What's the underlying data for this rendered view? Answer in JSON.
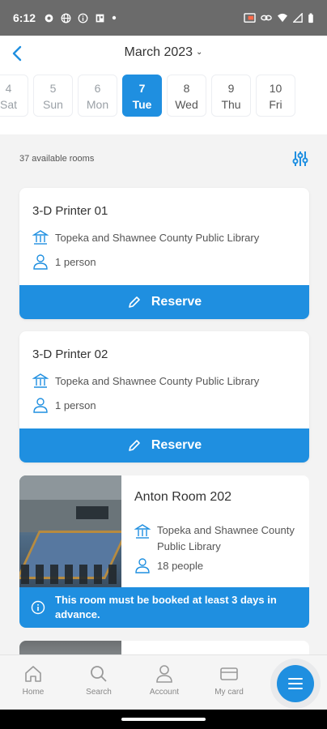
{
  "status_bar": {
    "time": "6:12"
  },
  "header": {
    "month_label": "March 2023"
  },
  "days": [
    {
      "num": "4",
      "dow": "Sat"
    },
    {
      "num": "5",
      "dow": "Sun"
    },
    {
      "num": "6",
      "dow": "Mon"
    },
    {
      "num": "7",
      "dow": "Tue"
    },
    {
      "num": "8",
      "dow": "Wed"
    },
    {
      "num": "9",
      "dow": "Thu"
    },
    {
      "num": "10",
      "dow": "Fri"
    }
  ],
  "selected_day": "7",
  "list": {
    "count_label": "37 available rooms"
  },
  "rooms": [
    {
      "name": "3-D Printer 01",
      "library": "Topeka and Shawnee County Public Library",
      "capacity": "1 person",
      "action_label": "Reserve"
    },
    {
      "name": "3-D Printer 02",
      "library": "Topeka and Shawnee County Public Library",
      "capacity": "1 person",
      "action_label": "Reserve"
    },
    {
      "name": "Anton Room 202",
      "library": "Topeka and Shawnee County Public Library",
      "capacity": "18 people",
      "notice": "This room must be booked at least 3 days in advance."
    }
  ],
  "bottom_nav": [
    {
      "label": "Home",
      "icon": "home-icon"
    },
    {
      "label": "Search",
      "icon": "search-icon"
    },
    {
      "label": "Account",
      "icon": "account-icon"
    },
    {
      "label": "My card",
      "icon": "card-icon"
    }
  ],
  "colors": {
    "accent": "#1f8fe0",
    "status_bar": "#6b6b6b"
  }
}
